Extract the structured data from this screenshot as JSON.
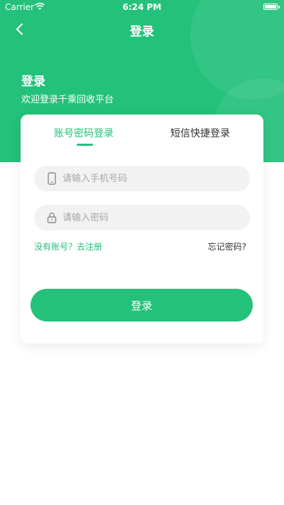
{
  "status_bar": {
    "carrier": "Carrier",
    "time": "6:24 PM"
  },
  "nav": {
    "title": "登录"
  },
  "hero": {
    "title": "登录",
    "subtitle": "欢迎登录千乘回收平台"
  },
  "tabs": [
    {
      "label": "账号密码登录",
      "active": true
    },
    {
      "label": "短信快捷登录",
      "active": false
    }
  ],
  "form": {
    "phone_placeholder": "请输入手机号码",
    "password_placeholder": "请输入密码",
    "phone_icon": "phone-icon",
    "lock_icon": "lock-icon"
  },
  "links": {
    "register": "没有账号？去注册",
    "forgot": "忘记密码?"
  },
  "login_button": "登录",
  "colors": {
    "accent": "#23c17a",
    "text": "#333333",
    "placeholder": "#a8a8a8",
    "field_bg": "#f2f2f2"
  }
}
